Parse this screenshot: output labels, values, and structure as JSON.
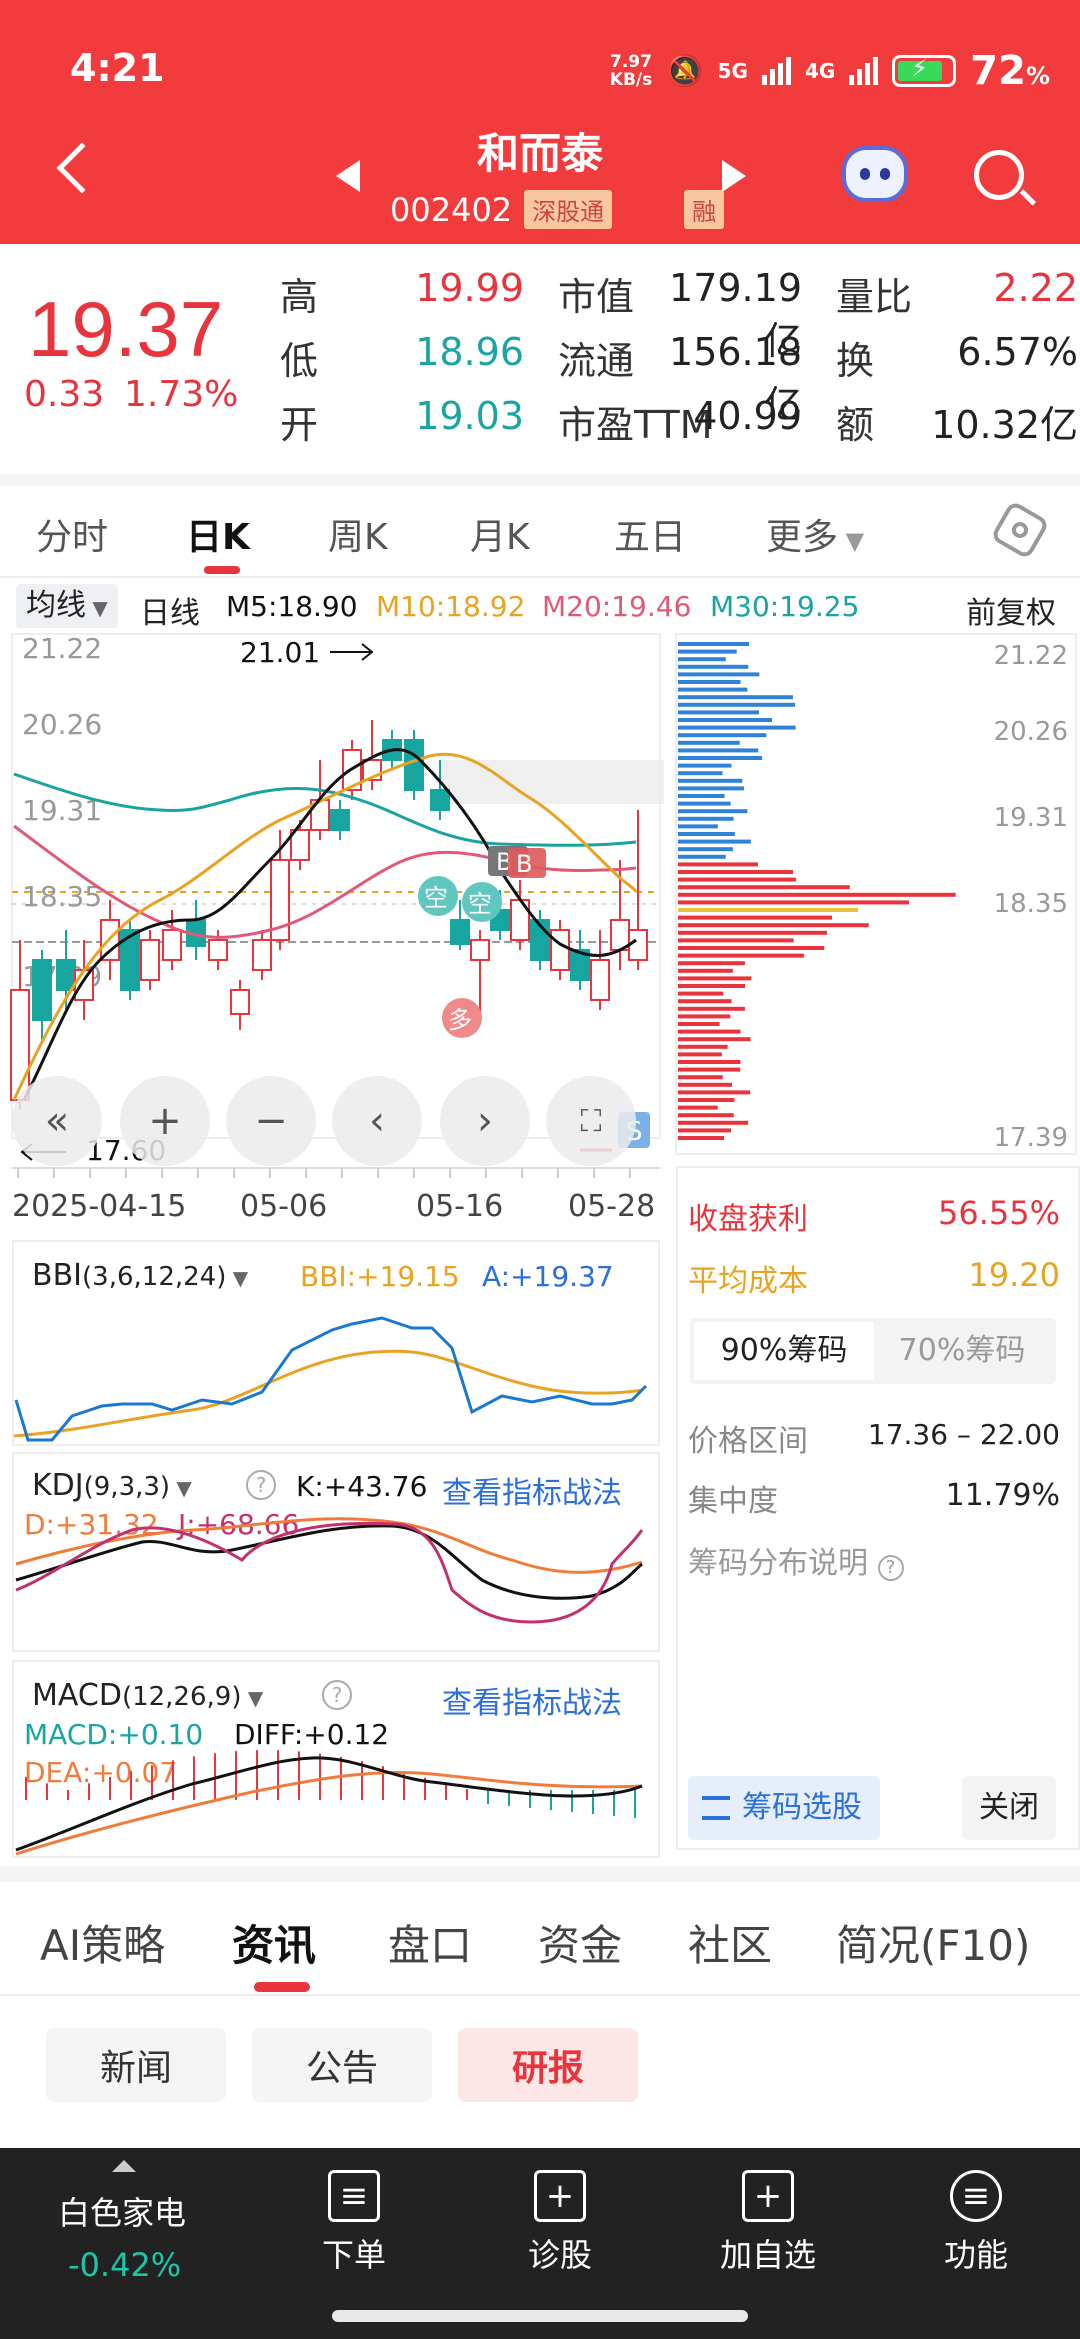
{
  "status": {
    "time": "4:21",
    "speed_top": "7.97",
    "speed_bottom": "KB/s",
    "net1": "5G",
    "net2": "4G",
    "battery": "72",
    "pct": "%"
  },
  "header": {
    "name": "和而泰",
    "code": "002402",
    "tag1": "深股通",
    "tag2": "融"
  },
  "quote": {
    "price": "19.37",
    "change": "0.33",
    "change_pct": "1.73%",
    "high_l": "高",
    "high": "19.99",
    "low_l": "低",
    "low": "18.96",
    "open_l": "开",
    "open": "19.03",
    "mcap_l": "市值",
    "mcap": "179.19亿",
    "float_l": "流通",
    "float": "156.18亿",
    "pe_l": "市盈TTM",
    "pe": "40.99",
    "vr_l": "量比",
    "vr": "2.22",
    "turn_l": "换",
    "turn": "6.57%",
    "amt_l": "额",
    "amt": "10.32亿"
  },
  "tabs": [
    "分时",
    "日K",
    "周K",
    "月K",
    "五日",
    "更多"
  ],
  "ma": {
    "sel": "均线",
    "kind": "日线",
    "m5": "M5:18.90",
    "m10": "M10:18.92",
    "m20": "M20:19.46",
    "m30": "M30:19.25",
    "adj": "前复权"
  },
  "kchart": {
    "y_ticks": [
      "21.22",
      "20.26",
      "19.31",
      "18.35",
      "17.39"
    ],
    "high_mark": "21.01",
    "low_mark": "17.60",
    "dates": [
      "2025-04-15",
      "05-06",
      "05-16",
      "05-28"
    ],
    "sig_s": "S",
    "sig_b": "B",
    "sig_kong": "空",
    "sig_duo": "多",
    "colors": {
      "up": "#e8343d",
      "down": "#17a5a0",
      "m5": "#000000",
      "m10": "#e8a322",
      "m20": "#e05a78",
      "m30": "#1aa3a0"
    }
  },
  "chips": {
    "y_ticks": [
      "21.22",
      "20.26",
      "19.31",
      "18.35",
      "17.39"
    ],
    "profit_l": "收盘获利",
    "profit": "56.55%",
    "cost_l": "平均成本",
    "cost": "19.20",
    "tab90": "90%筹码",
    "tab70": "70%筹码",
    "range_l": "价格区间",
    "range": "17.36 – 22.00",
    "conc_l": "集中度",
    "conc": "11.79%",
    "desc": "筹码分布说明",
    "select": "筹码选股",
    "close": "关闭"
  },
  "bbi": {
    "name": "BBI",
    "params": "(3,6,12,24)",
    "v1": "BBI:+19.15",
    "v2": "A:+19.37"
  },
  "kdj": {
    "name": "KDJ",
    "params": "(9,3,3)",
    "k": "K:+43.76",
    "d": "D:+31.32",
    "j": "J:+68.66",
    "link": "查看指标战法"
  },
  "macd": {
    "name": "MACD",
    "params": "(12,26,9)",
    "macd": "MACD:+0.10",
    "diff": "DIFF:+0.12",
    "dea": "DEA:+0.07",
    "link": "查看指标战法"
  },
  "btabs": [
    "AI策略",
    "资讯",
    "盘口",
    "资金",
    "社区",
    "简况(F10)"
  ],
  "pills": [
    "新闻",
    "公告",
    "研报"
  ],
  "bottom": {
    "sector": "白色家电",
    "sector_chg": "-0.42%",
    "items": [
      "下单",
      "诊股",
      "加自选",
      "功能"
    ]
  }
}
